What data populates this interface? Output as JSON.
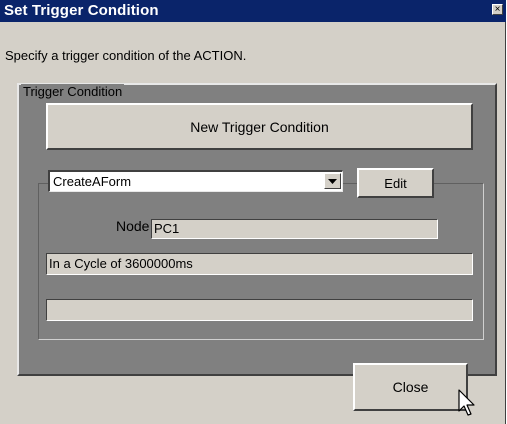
{
  "dialog": {
    "title": "Set Trigger Condition",
    "close_glyph": "×",
    "description": "Specify a trigger condition of the ACTION."
  },
  "trigger_group": {
    "label": "Trigger Condition",
    "new_button_label": "New Trigger Condition",
    "selected_condition": "CreateAForm",
    "edit_button_label": "Edit",
    "node_label": "Node",
    "node_value": "PC1",
    "cycle_text": "In a Cycle of 3600000ms",
    "extra_text": ""
  },
  "footer": {
    "close_button_label": "Close"
  },
  "icons": {
    "title_close": "close-icon",
    "combo_drop": "chevron-down-icon",
    "pointer": "mouse-cursor-icon"
  },
  "colors": {
    "titlebar": "#0a246a",
    "face": "#d4d0c8",
    "group_fill": "#808080"
  }
}
